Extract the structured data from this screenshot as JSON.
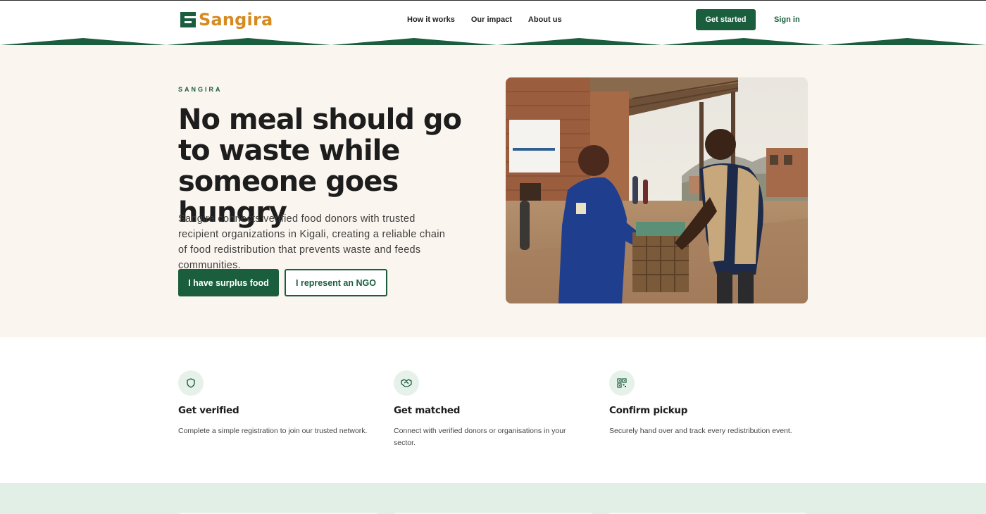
{
  "nav": {
    "brand": "Sangira",
    "links": [
      "How it works",
      "Our impact",
      "About us"
    ],
    "get_started": "Get started",
    "sign_in": "Sign in"
  },
  "hero": {
    "eyebrow": "SANGIRA",
    "headline": "No meal should go to waste while someone goes hungry",
    "subtext": "Sangira connects verified food donors with trusted recipient organizations in Kigali, creating a reliable chain of food redistribution that prevents waste and feeds communities.",
    "primary_cta": "I have surplus food",
    "secondary_cta": "I represent an NGO",
    "photo_icon": "food-handover-photo"
  },
  "features": [
    {
      "icon": "shield-icon",
      "title": "Get verified",
      "desc": "Complete a simple registration to join our trusted network."
    },
    {
      "icon": "handshake-icon",
      "title": "Get matched",
      "desc": "Connect with verified donors or organisations in your sector."
    },
    {
      "icon": "qr-code-icon",
      "title": "Confirm pickup",
      "desc": "Securely hand over and track every redistribution event."
    }
  ],
  "colors": {
    "brand_green": "#1b5e3e",
    "brand_orange": "#d68a1f",
    "hero_bg": "#faf5ee",
    "band_bg": "#e1efe6"
  }
}
